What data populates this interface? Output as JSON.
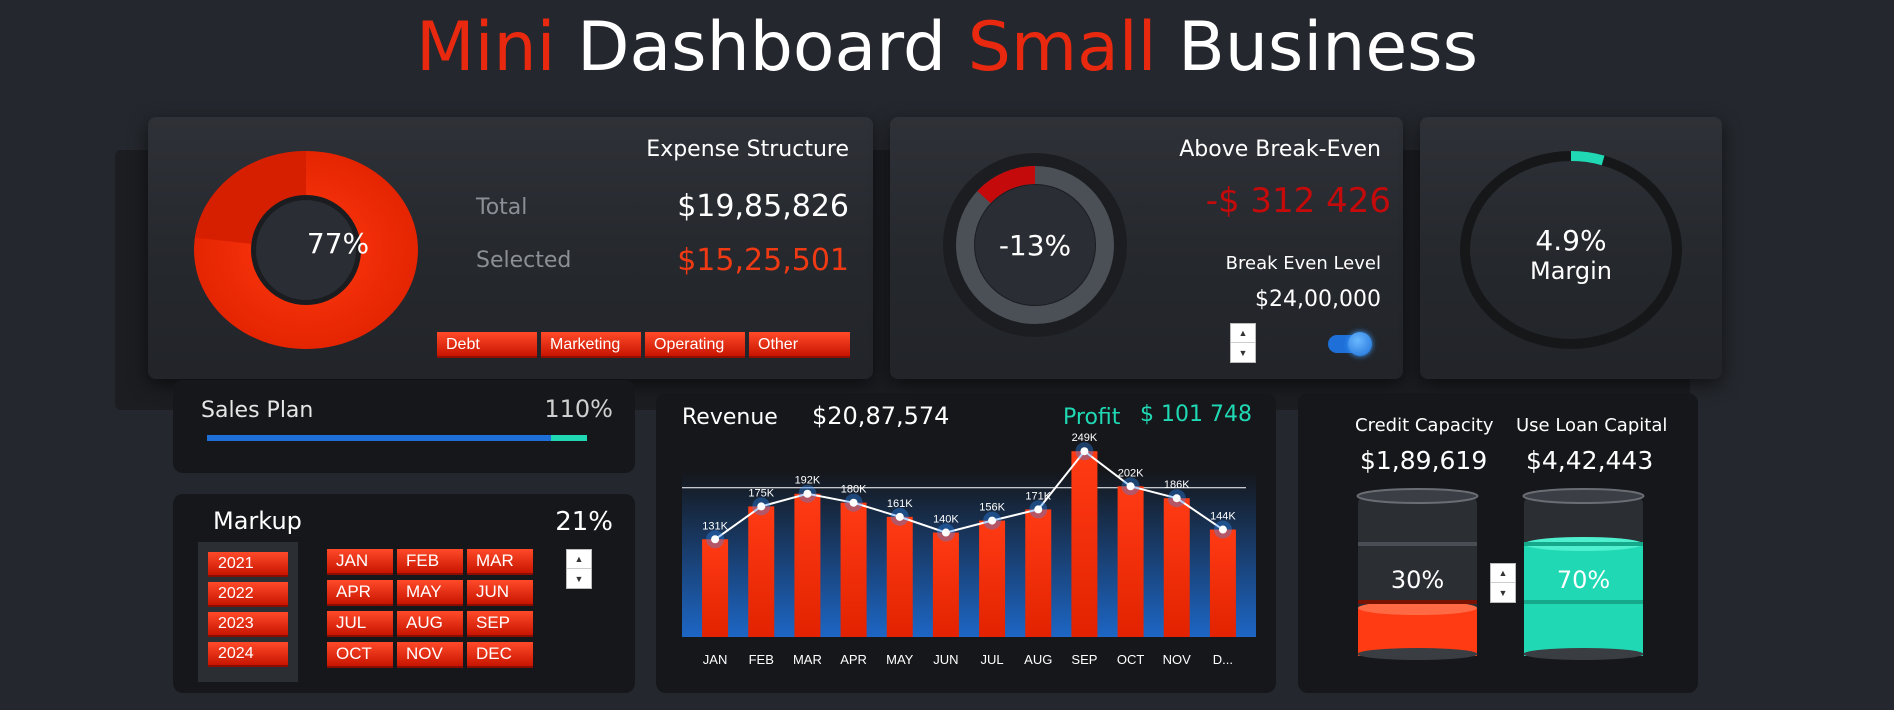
{
  "header": {
    "title_part1": "Mini",
    "title_part2": "Dashboard",
    "title_part3": "Small",
    "title_part4": "Business"
  },
  "expense": {
    "title": "Expense Structure",
    "donut_pct": "77%",
    "donut_fraction": 0.77,
    "total_label": "Total",
    "total_value": "$19,85,826",
    "selected_label": "Selected",
    "selected_value": "$15,25,501",
    "categories": [
      "Debt",
      "Marketing",
      "Operating",
      "Other"
    ]
  },
  "breakeven": {
    "title": "Above Break-Even",
    "value": "-$ 312 426",
    "ring_pct": "-13%",
    "ring_fraction": 0.13,
    "level_label": "Break Even Level",
    "level_value": "$24,00,000",
    "toggle_on": true
  },
  "margin": {
    "pct": "4.9%",
    "label": "Margin",
    "fraction": 0.049
  },
  "sales_plan": {
    "label": "Sales Plan",
    "pct": "110%",
    "fraction": 1.1
  },
  "markup": {
    "label": "Markup",
    "pct": "21%",
    "years": [
      "2021",
      "2022",
      "2023",
      "2024"
    ],
    "months": [
      "JAN",
      "FEB",
      "MAR",
      "APR",
      "MAY",
      "JUN",
      "JUL",
      "AUG",
      "SEP",
      "OCT",
      "NOV",
      "DEC"
    ]
  },
  "revenue": {
    "label": "Revenue",
    "value": "$20,87,574",
    "profit_label": "Profit",
    "profit_value": "$ 101 748"
  },
  "chart_data": {
    "type": "bar",
    "categories": [
      "JAN",
      "FEB",
      "MAR",
      "APR",
      "MAY",
      "JUN",
      "JUL",
      "AUG",
      "SEP",
      "OCT",
      "NOV",
      "D..."
    ],
    "series": [
      {
        "values": [
          131,
          175,
          192,
          180,
          161,
          140,
          156,
          171,
          249,
          202,
          186,
          144
        ]
      }
    ],
    "data_labels": [
      "131K",
      "175K",
      "192K",
      "180K",
      "161K",
      "140K",
      "156K",
      "171K",
      "249K",
      "202K",
      "186K",
      "144K"
    ],
    "reference_line": 200,
    "ylim": [
      0,
      260
    ],
    "title": "",
    "xlabel": "",
    "ylabel": ""
  },
  "credit": {
    "capacity_label": "Credit Capacity",
    "capacity_value": "$1,89,619",
    "loan_label": "Use Loan Capital",
    "loan_value": "$4,42,443",
    "left_pct": "30%",
    "left_fraction": 0.3,
    "right_pct": "70%",
    "right_fraction": 0.7
  },
  "colors": {
    "accent_red": "#e8290f",
    "accent_teal": "#20d9b4",
    "blue": "#1e7be6",
    "dark_red": "#c40a0a"
  }
}
